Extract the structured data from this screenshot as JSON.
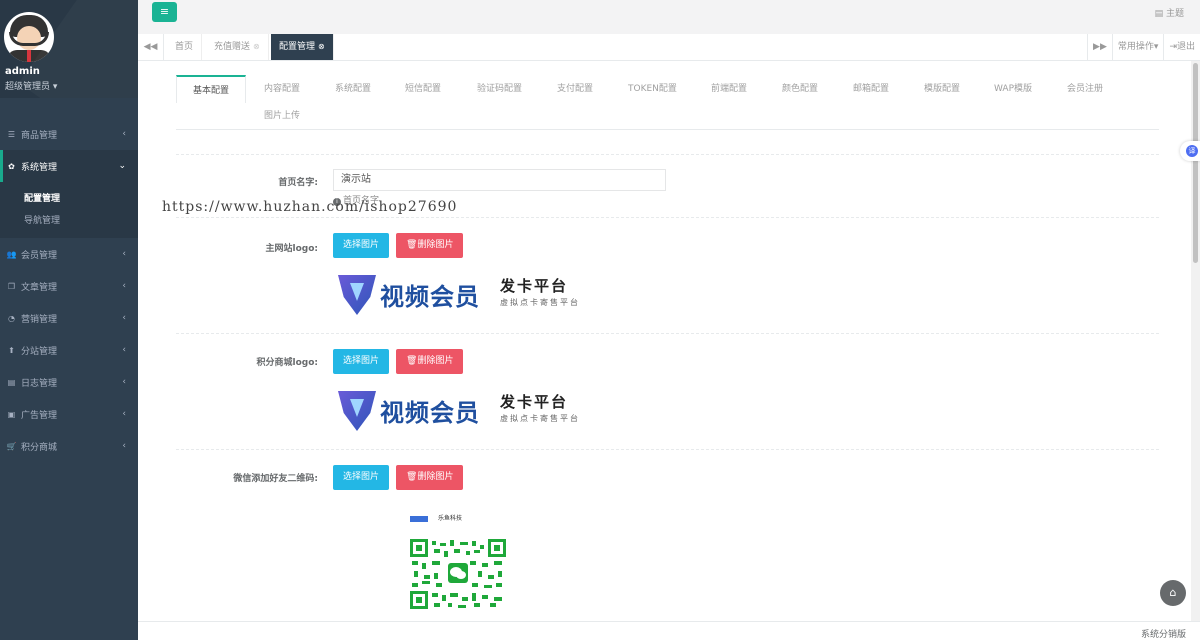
{
  "sidebar": {
    "user_name": "admin",
    "user_role": "超级管理员",
    "menu": [
      {
        "label": "商品管理",
        "icon": "list-icon"
      },
      {
        "label": "系统管理",
        "icon": "gear-icon",
        "active": true
      },
      {
        "label": "会员管理",
        "icon": "users-icon"
      },
      {
        "label": "文章管理",
        "icon": "copy-icon"
      },
      {
        "label": "营销管理",
        "icon": "pie-chart-icon"
      },
      {
        "label": "分站管理",
        "icon": "arrow-up-icon"
      },
      {
        "label": "日志管理",
        "icon": "file-icon"
      },
      {
        "label": "广告管理",
        "icon": "image-icon"
      },
      {
        "label": "积分商城",
        "icon": "cart-icon"
      }
    ],
    "submenu": [
      {
        "label": "配置管理",
        "current": true
      },
      {
        "label": "导航管理"
      }
    ]
  },
  "topbar": {
    "theme_label": "主题"
  },
  "tabs": {
    "items": [
      {
        "label": "首页"
      },
      {
        "label": "充值赠送"
      },
      {
        "label": "配置管理",
        "active": true
      }
    ],
    "actions_label": "常用操作",
    "logout_label": "退出"
  },
  "subtabs": [
    {
      "label": "基本配置",
      "active": true
    },
    {
      "label": "内容配置"
    },
    {
      "label": "系统配置"
    },
    {
      "label": "短信配置"
    },
    {
      "label": "验证码配置"
    },
    {
      "label": "支付配置"
    },
    {
      "label": "TOKEN配置"
    },
    {
      "label": "前端配置"
    },
    {
      "label": "颜色配置"
    },
    {
      "label": "邮箱配置"
    },
    {
      "label": "模版配置"
    },
    {
      "label": "WAP模版"
    },
    {
      "label": "会员注册"
    },
    {
      "label": "图片上传"
    }
  ],
  "form": {
    "site_name_label": "首页名字:",
    "site_name_value": "演示站",
    "site_name_help": "首页名字",
    "main_logo_label": "主网站logo:",
    "points_logo_label": "积分商城logo:",
    "wechat_qr_label": "微信添加好友二维码:",
    "select_image": "选择图片",
    "delete_image": "删除图片",
    "logo_text_main": "视频会员",
    "logo_text_side": "发卡平台",
    "logo_text_sub": "虚拟点卡寄售平台",
    "qr_company": "乐鱼科技"
  },
  "watermark": "https://www.huzhan.com/ishop27690",
  "footer": "系统分销版"
}
